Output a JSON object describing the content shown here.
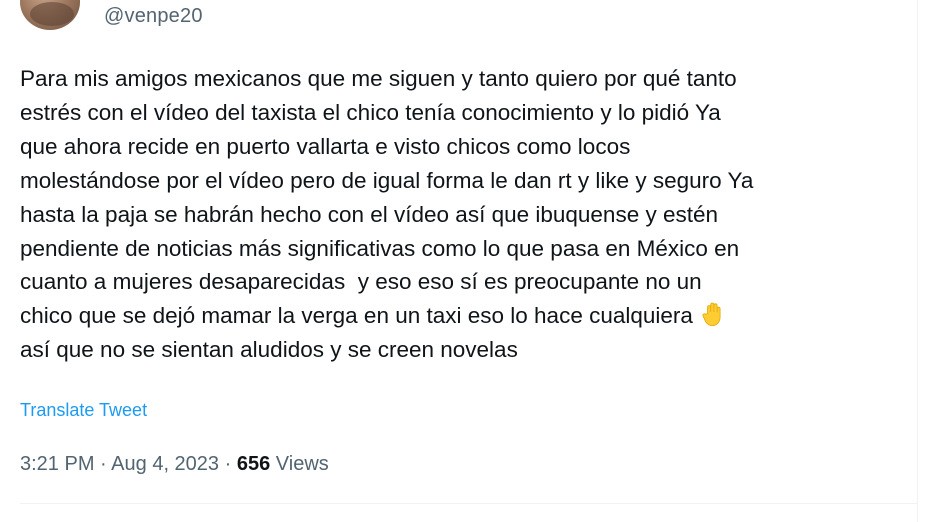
{
  "author": {
    "handle": "@venpe20"
  },
  "tweet": {
    "text_lines": [
      "Para mis amigos mexicanos que me siguen y tanto quiero por qué tanto",
      "estrés con el vídeo del taxista el chico tenía conocimiento y lo pidió Ya",
      "que ahora recide en puerto vallarta e visto chicos como locos",
      "molestándose por el vídeo pero de igual forma le dan rt y like y seguro Ya",
      "hasta la paja se habrán hecho con el vídeo así que ibuquense y estén",
      "pendiente de noticias más significativas como lo que pasa en México en",
      "cuanto a mujeres desaparecidas  y eso eso sí es preocupante no un",
      "chico que se dejó mamar la verga en un taxi eso lo hace cualquiera",
      "así que no se sientan aludidos y se creen novelas"
    ],
    "emoji": "raised-hand-emoji",
    "translate_label": "Translate Tweet"
  },
  "meta": {
    "time": "3:21 PM",
    "separator": "·",
    "date": "Aug 4, 2023",
    "views_count": "656",
    "views_label": "Views"
  },
  "colors": {
    "text": "#0f1419",
    "secondary": "#536471",
    "link": "#1d9bf0",
    "divider": "#eff3f4",
    "emoji": "#ffcc33"
  }
}
